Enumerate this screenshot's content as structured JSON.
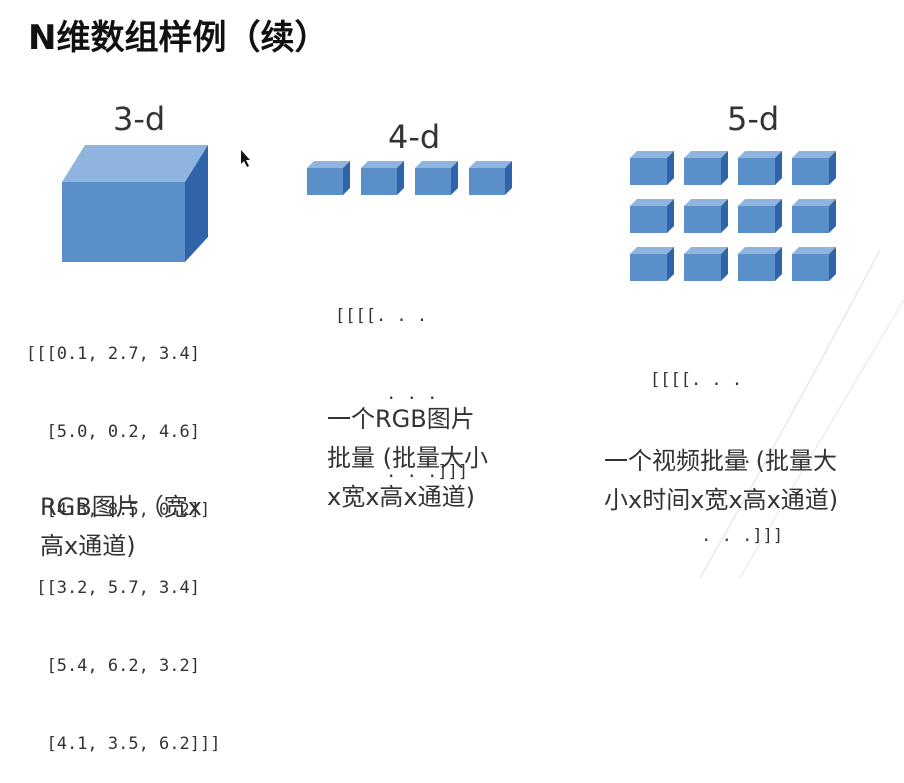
{
  "slide": {
    "title": "N维数组样例（续）",
    "panels": [
      {
        "label": "3-d",
        "array_lines": [
          "[[[0.1, 2.7, 3.4]",
          "  [5.0, 0.2, 4.6]",
          "  [4.3, 8.5, 0.2]]",
          " [[3.2, 5.7, 3.4]",
          "  [5.4, 6.2, 3.2]",
          "  [4.1, 3.5, 6.2]]]"
        ],
        "caption_lines": [
          "RGB图片（宽x",
          "高x通道)"
        ]
      },
      {
        "label": "4-d",
        "array_lines": [
          "[[[[. . .",
          "     . . .",
          "     . . .]]]"
        ],
        "caption_lines": [
          "一个RGB图片",
          "批量 (批量大小",
          "x宽x高x通道)"
        ]
      },
      {
        "label": "5-d",
        "array_lines": [
          "[[[[. . .",
          "     . . .",
          "     . . .]]]"
        ],
        "caption_lines": [
          "一个视频批量 (批量大",
          "小x时间x宽x高x通道)"
        ]
      }
    ]
  },
  "colors": {
    "cube_front": "#5b8fc9",
    "cube_top": "#8fb5de",
    "cube_side": "#2f64a8",
    "text": "#333333"
  }
}
